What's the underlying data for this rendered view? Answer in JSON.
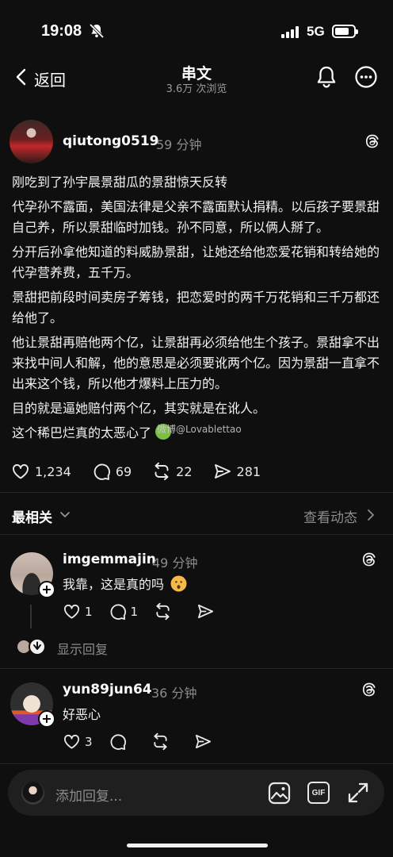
{
  "status_bar": {
    "time": "19:08",
    "network": "5G"
  },
  "header": {
    "back_label": "返回",
    "title": "串文",
    "subtitle": "3.6万 次浏览"
  },
  "post": {
    "username": "qiutong0519",
    "time": "59 分钟",
    "paragraphs": [
      "刚吃到了孙宇晨景甜瓜的景甜惊天反转",
      "代孕孙不露面，美国法律是父亲不露面默认捐精。以后孩子要景甜自己养，所以景甜临时加钱。孙不同意，所以俩人掰了。",
      "分开后孙拿他知道的料威胁景甜，让她还给他恋爱花销和转给她的代孕营养费，五千万。",
      "景甜把前段时间卖房子筹钱，把恋爱时的两千万花销和三千万都还给他了。",
      "他让景甜再赔他两个亿，让景甜再必须给他生个孩子。景甜拿不出来找中间人和解，他的意思是必须要讹两个亿。因为景甜一直拿不出来这个钱，所以他才爆料上压力的。",
      "目的就是逼她赔付两个亿，其实就是在讹人。",
      "这个稀巴烂真的太恶心了"
    ],
    "watermark": "微博@Lovablettao",
    "likes": "1,234",
    "comments": "69",
    "reposts": "22",
    "shares": "281"
  },
  "sort": {
    "label": "最相关",
    "activity": "查看动态"
  },
  "comments": [
    {
      "username": "imgemmajin",
      "time": "49 分钟",
      "text": "我靠，这是真的吗",
      "likes": "1",
      "replies": "1"
    },
    {
      "username": "yun89jun64",
      "time": "36 分钟",
      "text": "好恶心",
      "likes": "3"
    }
  ],
  "show_replies": "显示回复",
  "composer": {
    "placeholder": "添加回复...",
    "gif": "GIF"
  },
  "icons": {
    "back": "chevron-left-icon",
    "notification": "bell-icon",
    "more": "ellipsis-circle-icon",
    "threads": "threads-logo-icon",
    "like": "heart-icon",
    "comment": "speech-bubble-icon",
    "repost": "repost-icon",
    "share": "send-icon"
  },
  "colors": {
    "background": "#0f0f0f",
    "text": "#f2f2f2",
    "muted": "#8c8c8c"
  }
}
